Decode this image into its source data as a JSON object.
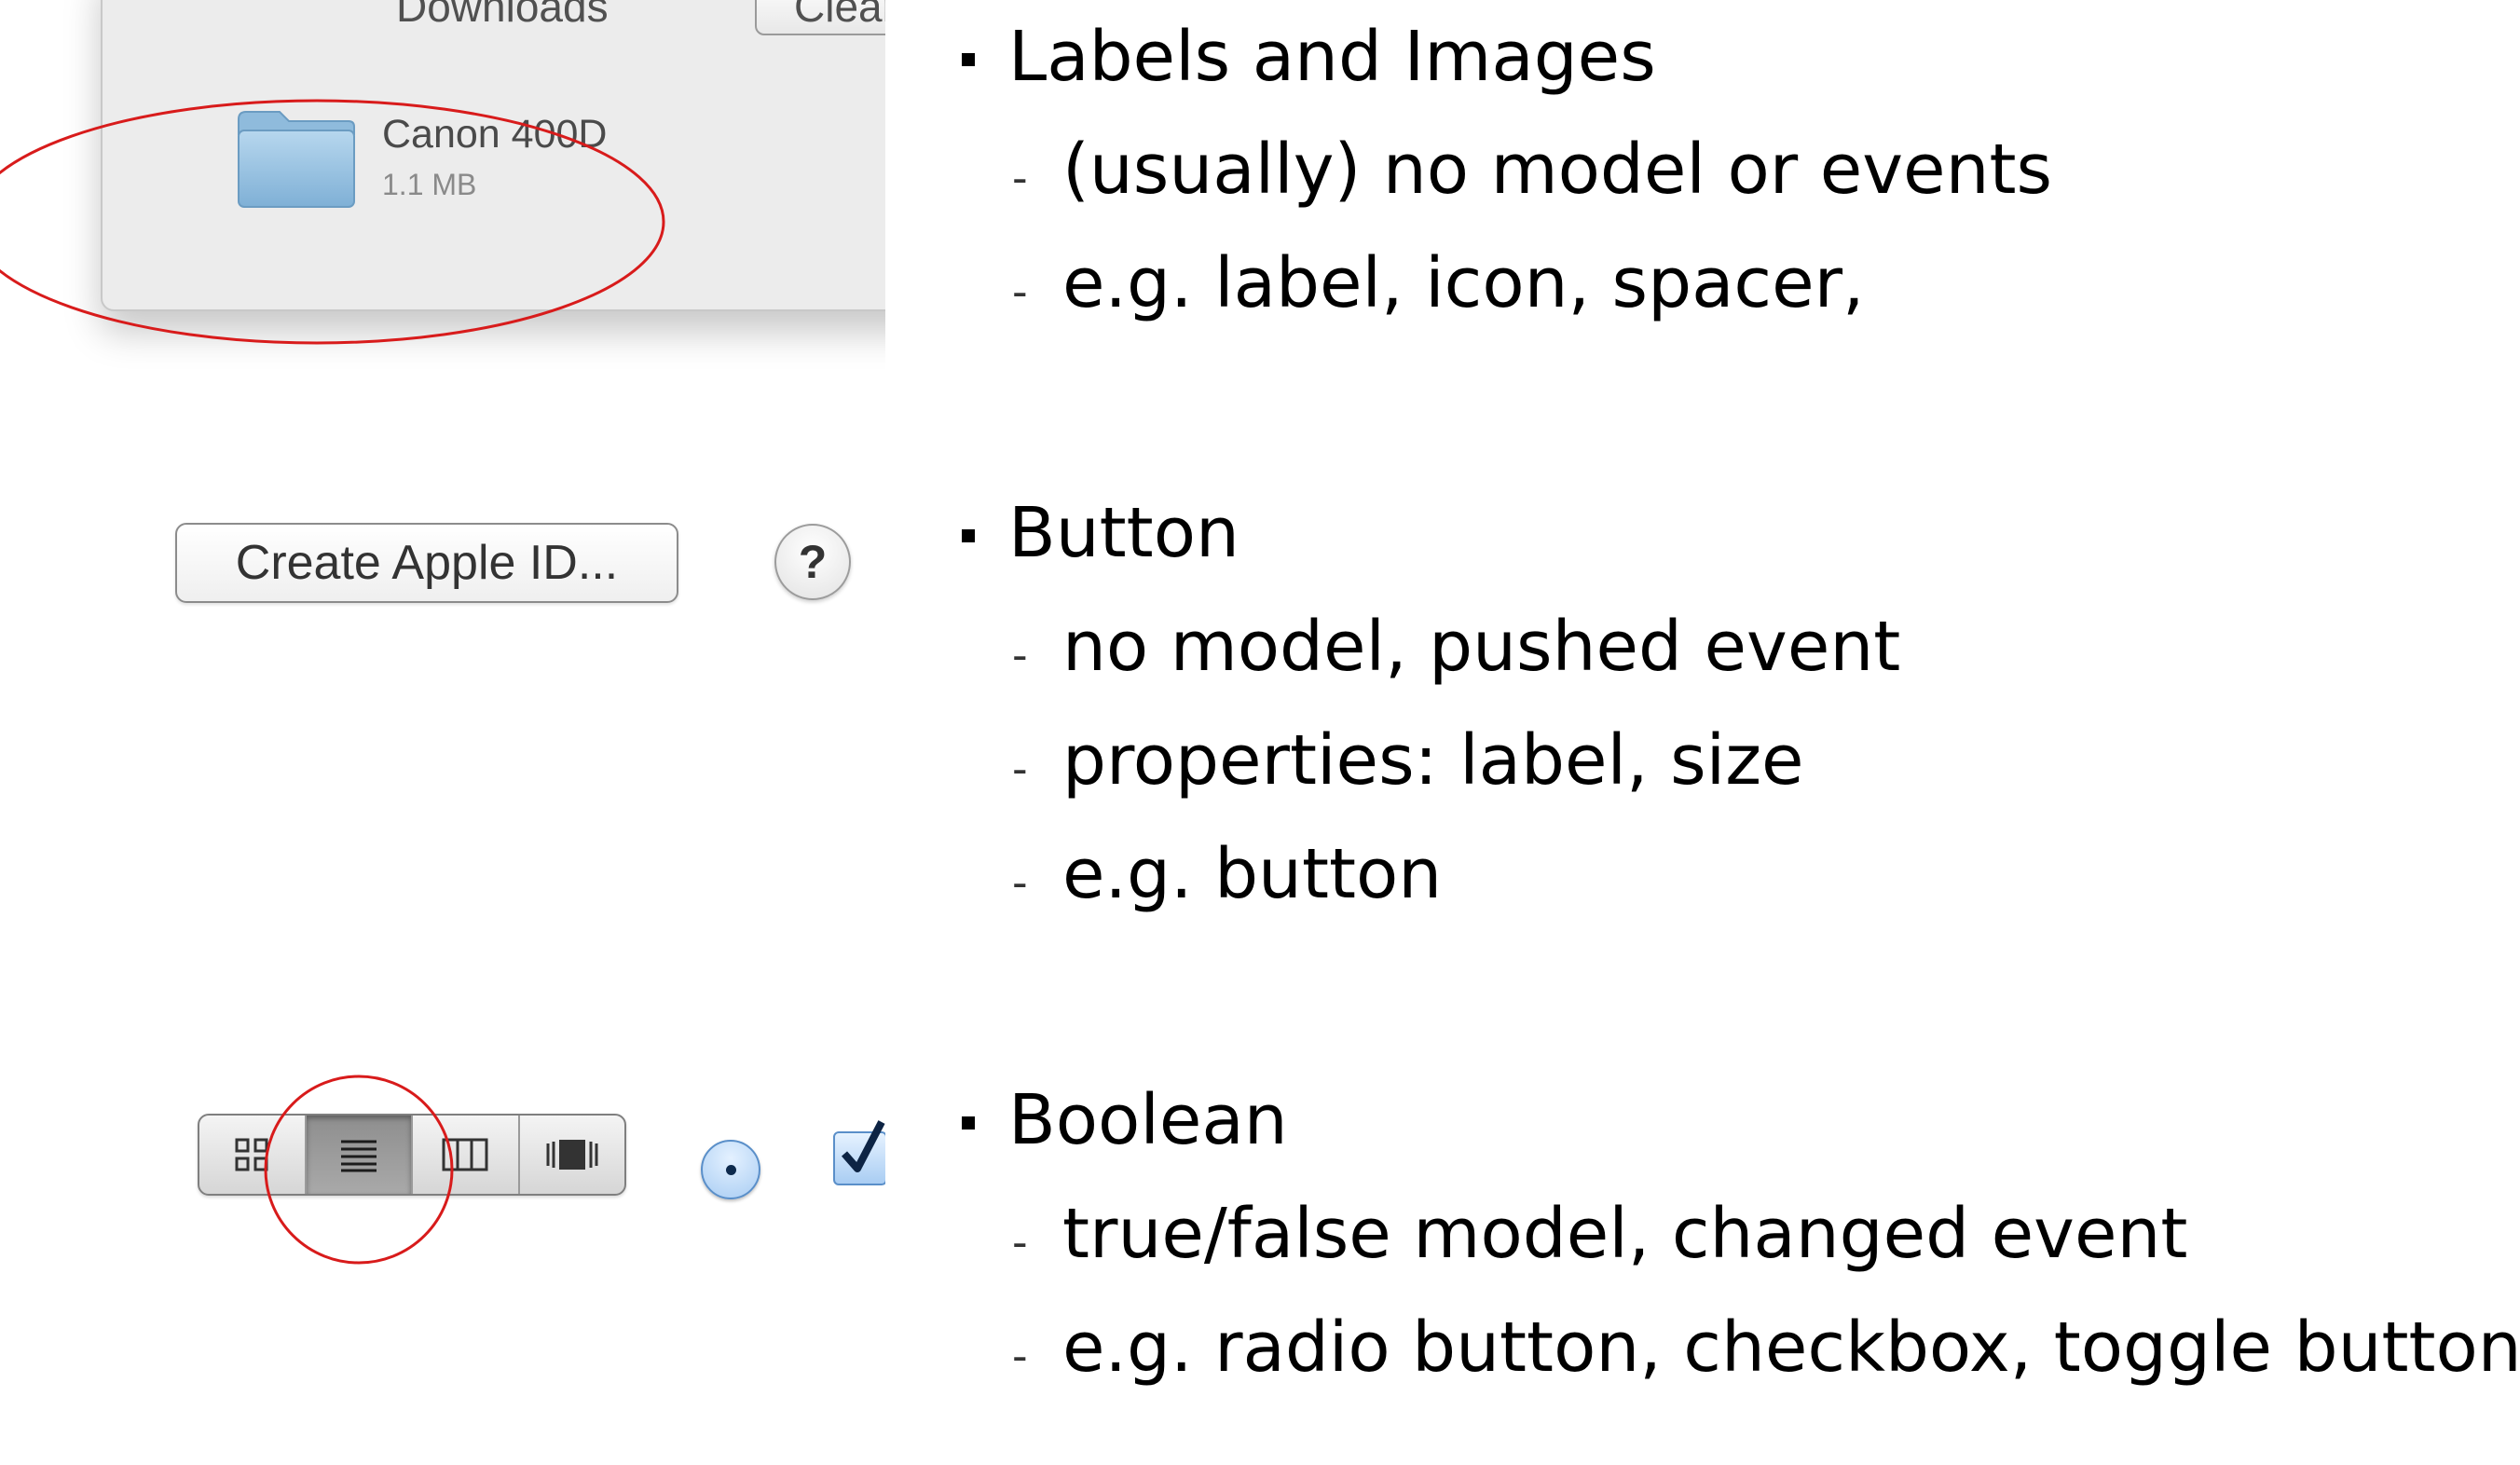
{
  "downloads_panel": {
    "title": "Downloads",
    "clear_label": "Clear",
    "item_name": "Canon 400D",
    "item_size": "1.1 MB",
    "highlight_color": "#d81b1b"
  },
  "button_example": {
    "label": "Create Apple ID...",
    "help_label": "?"
  },
  "boolean_example": {
    "view_modes": [
      "icon-view-icon",
      "list-view-icon",
      "column-view-icon",
      "cover-flow-icon"
    ],
    "selected_view": "list-view-icon",
    "radio_selected": true,
    "checkbox_checked": true
  },
  "sections": [
    {
      "heading": "Labels and Images",
      "items": [
        "(usually) no model or events",
        "e.g. label, icon, spacer,"
      ]
    },
    {
      "heading": "Button",
      "items": [
        "no model, pushed event",
        "properties: label, size",
        "e.g. button"
      ]
    },
    {
      "heading": "Boolean",
      "items": [
        "true/false model, changed event",
        "e.g. radio button, checkbox, toggle button"
      ]
    }
  ]
}
